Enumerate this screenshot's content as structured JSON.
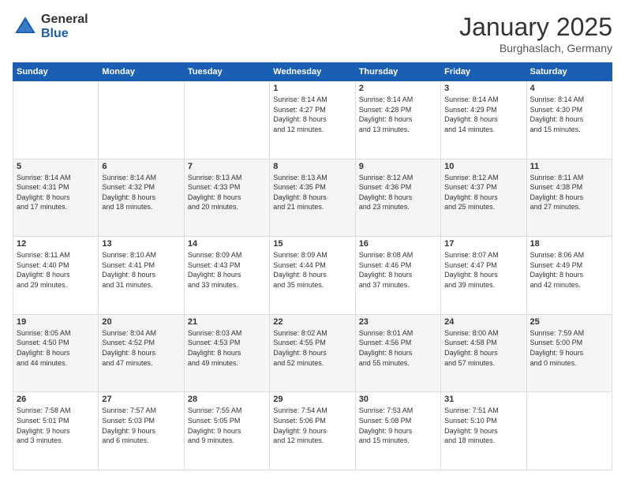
{
  "logo": {
    "general": "General",
    "blue": "Blue"
  },
  "header": {
    "month": "January 2025",
    "location": "Burghaslach, Germany"
  },
  "weekdays": [
    "Sunday",
    "Monday",
    "Tuesday",
    "Wednesday",
    "Thursday",
    "Friday",
    "Saturday"
  ],
  "weeks": [
    [
      {
        "day": "",
        "info": ""
      },
      {
        "day": "",
        "info": ""
      },
      {
        "day": "",
        "info": ""
      },
      {
        "day": "1",
        "info": "Sunrise: 8:14 AM\nSunset: 4:27 PM\nDaylight: 8 hours\nand 12 minutes."
      },
      {
        "day": "2",
        "info": "Sunrise: 8:14 AM\nSunset: 4:28 PM\nDaylight: 8 hours\nand 13 minutes."
      },
      {
        "day": "3",
        "info": "Sunrise: 8:14 AM\nSunset: 4:29 PM\nDaylight: 8 hours\nand 14 minutes."
      },
      {
        "day": "4",
        "info": "Sunrise: 8:14 AM\nSunset: 4:30 PM\nDaylight: 8 hours\nand 15 minutes."
      }
    ],
    [
      {
        "day": "5",
        "info": "Sunrise: 8:14 AM\nSunset: 4:31 PM\nDaylight: 8 hours\nand 17 minutes."
      },
      {
        "day": "6",
        "info": "Sunrise: 8:14 AM\nSunset: 4:32 PM\nDaylight: 8 hours\nand 18 minutes."
      },
      {
        "day": "7",
        "info": "Sunrise: 8:13 AM\nSunset: 4:33 PM\nDaylight: 8 hours\nand 20 minutes."
      },
      {
        "day": "8",
        "info": "Sunrise: 8:13 AM\nSunset: 4:35 PM\nDaylight: 8 hours\nand 21 minutes."
      },
      {
        "day": "9",
        "info": "Sunrise: 8:12 AM\nSunset: 4:36 PM\nDaylight: 8 hours\nand 23 minutes."
      },
      {
        "day": "10",
        "info": "Sunrise: 8:12 AM\nSunset: 4:37 PM\nDaylight: 8 hours\nand 25 minutes."
      },
      {
        "day": "11",
        "info": "Sunrise: 8:11 AM\nSunset: 4:38 PM\nDaylight: 8 hours\nand 27 minutes."
      }
    ],
    [
      {
        "day": "12",
        "info": "Sunrise: 8:11 AM\nSunset: 4:40 PM\nDaylight: 8 hours\nand 29 minutes."
      },
      {
        "day": "13",
        "info": "Sunrise: 8:10 AM\nSunset: 4:41 PM\nDaylight: 8 hours\nand 31 minutes."
      },
      {
        "day": "14",
        "info": "Sunrise: 8:09 AM\nSunset: 4:43 PM\nDaylight: 8 hours\nand 33 minutes."
      },
      {
        "day": "15",
        "info": "Sunrise: 8:09 AM\nSunset: 4:44 PM\nDaylight: 8 hours\nand 35 minutes."
      },
      {
        "day": "16",
        "info": "Sunrise: 8:08 AM\nSunset: 4:46 PM\nDaylight: 8 hours\nand 37 minutes."
      },
      {
        "day": "17",
        "info": "Sunrise: 8:07 AM\nSunset: 4:47 PM\nDaylight: 8 hours\nand 39 minutes."
      },
      {
        "day": "18",
        "info": "Sunrise: 8:06 AM\nSunset: 4:49 PM\nDaylight: 8 hours\nand 42 minutes."
      }
    ],
    [
      {
        "day": "19",
        "info": "Sunrise: 8:05 AM\nSunset: 4:50 PM\nDaylight: 8 hours\nand 44 minutes."
      },
      {
        "day": "20",
        "info": "Sunrise: 8:04 AM\nSunset: 4:52 PM\nDaylight: 8 hours\nand 47 minutes."
      },
      {
        "day": "21",
        "info": "Sunrise: 8:03 AM\nSunset: 4:53 PM\nDaylight: 8 hours\nand 49 minutes."
      },
      {
        "day": "22",
        "info": "Sunrise: 8:02 AM\nSunset: 4:55 PM\nDaylight: 8 hours\nand 52 minutes."
      },
      {
        "day": "23",
        "info": "Sunrise: 8:01 AM\nSunset: 4:56 PM\nDaylight: 8 hours\nand 55 minutes."
      },
      {
        "day": "24",
        "info": "Sunrise: 8:00 AM\nSunset: 4:58 PM\nDaylight: 8 hours\nand 57 minutes."
      },
      {
        "day": "25",
        "info": "Sunrise: 7:59 AM\nSunset: 5:00 PM\nDaylight: 9 hours\nand 0 minutes."
      }
    ],
    [
      {
        "day": "26",
        "info": "Sunrise: 7:58 AM\nSunset: 5:01 PM\nDaylight: 9 hours\nand 3 minutes."
      },
      {
        "day": "27",
        "info": "Sunrise: 7:57 AM\nSunset: 5:03 PM\nDaylight: 9 hours\nand 6 minutes."
      },
      {
        "day": "28",
        "info": "Sunrise: 7:55 AM\nSunset: 5:05 PM\nDaylight: 9 hours\nand 9 minutes."
      },
      {
        "day": "29",
        "info": "Sunrise: 7:54 AM\nSunset: 5:06 PM\nDaylight: 9 hours\nand 12 minutes."
      },
      {
        "day": "30",
        "info": "Sunrise: 7:53 AM\nSunset: 5:08 PM\nDaylight: 9 hours\nand 15 minutes."
      },
      {
        "day": "31",
        "info": "Sunrise: 7:51 AM\nSunset: 5:10 PM\nDaylight: 9 hours\nand 18 minutes."
      },
      {
        "day": "",
        "info": ""
      }
    ]
  ]
}
